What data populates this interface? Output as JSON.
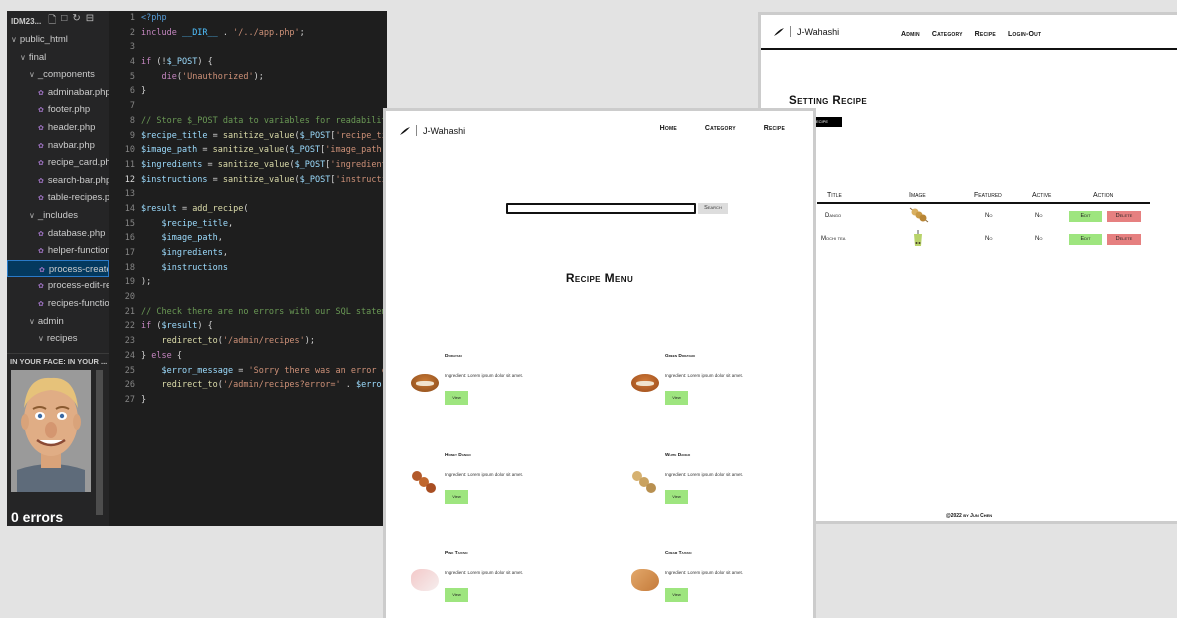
{
  "editor": {
    "explorer_title": "IDM23...",
    "tree": [
      {
        "label": "public_html",
        "type": "folder",
        "indent": 0
      },
      {
        "label": "final",
        "type": "folder",
        "indent": 1
      },
      {
        "label": "_components",
        "type": "folder",
        "indent": 2
      },
      {
        "label": "adminabar.php",
        "type": "file",
        "indent": 3
      },
      {
        "label": "footer.php",
        "type": "file",
        "indent": 3
      },
      {
        "label": "header.php",
        "type": "file",
        "indent": 3
      },
      {
        "label": "navbar.php",
        "type": "file",
        "indent": 3
      },
      {
        "label": "recipe_card.php",
        "type": "file",
        "indent": 3
      },
      {
        "label": "search-bar.php",
        "type": "file",
        "indent": 3
      },
      {
        "label": "table-recipes.php",
        "type": "file",
        "indent": 3
      },
      {
        "label": "_includes",
        "type": "folder",
        "indent": 2
      },
      {
        "label": "database.php",
        "type": "file",
        "indent": 3
      },
      {
        "label": "helper-functions...",
        "type": "file",
        "indent": 3
      },
      {
        "label": "process-create-...",
        "type": "file",
        "indent": 3,
        "selected": true
      },
      {
        "label": "process-edit-re...",
        "type": "file",
        "indent": 3
      },
      {
        "label": "recipes-function...",
        "type": "file",
        "indent": 3
      },
      {
        "label": "admin",
        "type": "folder",
        "indent": 2
      },
      {
        "label": "recipes",
        "type": "folder",
        "indent": 3
      }
    ],
    "preview_title": "IN YOUR FACE: IN YOUR ...",
    "errors_label": "0 errors",
    "active_line": 12,
    "code_lines": [
      "<?php",
      "include __DIR__ . '/../app.php';",
      "",
      "if (!$_POST) {",
      "    die('Unauthorized');",
      "}",
      "",
      "// Store $_POST data to variables for readability",
      "$recipe_title = sanitize_value($_POST['recipe_title']);",
      "$image_path = sanitize_value($_POST['image_path']);",
      "$ingredients = sanitize_value($_POST['ingredients']);",
      "$instructions = sanitize_value($_POST['instructions']);",
      "",
      "$result = add_recipe(",
      "    $recipe_title,",
      "    $image_path,",
      "    $ingredients,",
      "    $instructions",
      ");",
      "",
      "// Check there are no errors with our SQL statement",
      "if ($result) {",
      "    redirect_to('/admin/recipes');",
      "} else {",
      "    $error_message = 'Sorry there was an error creating",
      "    redirect_to('/admin/recipes?error=' . $error_message",
      "}"
    ]
  },
  "admin": {
    "brand": "J-Wahashi",
    "nav": [
      "Admin",
      "Category",
      "Recipe",
      "Login-Out"
    ],
    "title": "Setting Recipe",
    "create_button": "ecipe",
    "columns": [
      "Title",
      "Image",
      "Featured",
      "Active",
      "Action"
    ],
    "rows": [
      {
        "title": "Dango",
        "featured": "No",
        "active": "No",
        "edit": "Edit",
        "delete": "Delete"
      },
      {
        "title": "Mochi tea",
        "featured": "No",
        "active": "No",
        "edit": "Edit",
        "delete": "Delete"
      }
    ],
    "footer": "@2022 by Jun Chen"
  },
  "menu": {
    "brand": "J-Wahashi",
    "nav": [
      "Home",
      "Category",
      "Recipe"
    ],
    "search_button": "Search",
    "title": "Recipe Menu",
    "cards": [
      {
        "name": "Dorayaki",
        "ingredients": "Ingredient: Lorem ipsum dolor sit amet.",
        "button": "View",
        "icon": "dorayaki-icon"
      },
      {
        "name": "Green Dorayaki",
        "ingredients": "Ingredient: Lorem ipsum dolor sit amet.",
        "button": "View",
        "icon": "green-dorayaki-icon"
      },
      {
        "name": "Honey Dango",
        "ingredients": "Ingredient: Lorem ipsum dolor sit amet.",
        "button": "View",
        "icon": "honey-dango-icon"
      },
      {
        "name": "White Dango",
        "ingredients": "Ingredient: Lorem ipsum dolor sit amet.",
        "button": "View",
        "icon": "white-dango-icon"
      },
      {
        "name": "Pink Taiyaki",
        "ingredients": "Ingredient: Lorem ipsum dolor sit amet.",
        "button": "View",
        "icon": "pink-taiyaki-icon"
      },
      {
        "name": "Cream Taiyaki",
        "ingredients": "Ingredient: Lorem ipsum dolor sit amet.",
        "button": "View",
        "icon": "cream-taiyaki-icon"
      }
    ]
  }
}
